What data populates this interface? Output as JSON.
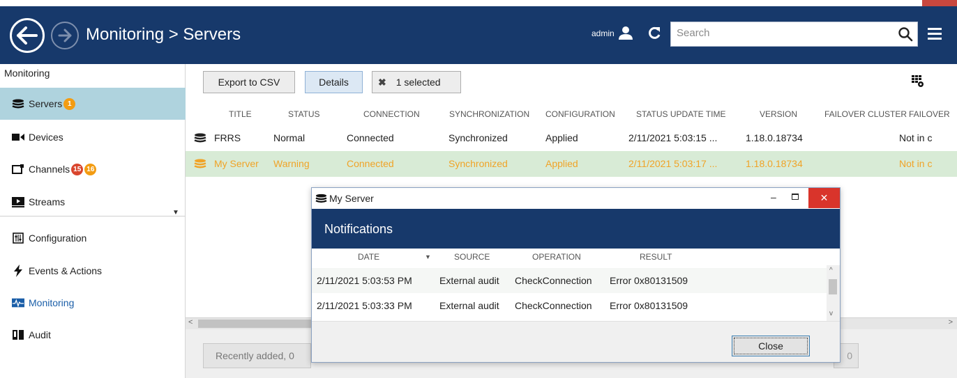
{
  "header": {
    "title": "Monitoring > Servers",
    "user": "admin",
    "search_placeholder": "Search",
    "icons": [
      "back-arrow-icon",
      "forward-arrow-icon",
      "user-icon",
      "refresh-icon",
      "search-icon",
      "menu-icon"
    ],
    "accent": "#17396b"
  },
  "sidebar": {
    "header": "Monitoring",
    "items": [
      {
        "label": "Servers",
        "icon": "server-stack-icon",
        "badges": [
          "1"
        ],
        "active": true
      },
      {
        "label": "Devices",
        "icon": "camera-icon",
        "badges": []
      },
      {
        "label": "Channels",
        "icon": "channel-icon",
        "badges": [
          "15",
          "16"
        ]
      },
      {
        "label": "Streams",
        "icon": "stream-icon",
        "badges": []
      },
      {
        "label": "Configuration",
        "icon": "configuration-icon",
        "badges": []
      },
      {
        "label": "Events & Actions",
        "icon": "lightning-icon",
        "badges": []
      },
      {
        "label": "Monitoring",
        "icon": "monitoring-icon",
        "badges": []
      },
      {
        "label": "Audit",
        "icon": "book-icon",
        "badges": []
      }
    ]
  },
  "toolbar": {
    "export_label": "Export to CSV",
    "details_label": "Details",
    "selected_label": "1 selected",
    "selected_icon": "clear-selection-icon",
    "grid_icon": "grid-settings-icon"
  },
  "table": {
    "columns": [
      "TITLE",
      "STATUS",
      "CONNECTION",
      "SYNCHRONIZATION",
      "CONFIGURATION",
      "STATUS UPDATE TIME",
      "VERSION",
      "FAILOVER CLUSTER",
      "FAILOVER"
    ],
    "rows": [
      {
        "title": "FRRS",
        "status": "Normal",
        "connection": "Connected",
        "sync": "Synchronized",
        "config": "Applied",
        "time": "2/11/2021 5:03:15 ...",
        "version": "1.18.0.18734",
        "cluster": "",
        "failover": "Not in c"
      },
      {
        "title": "My Server",
        "status": "Warning",
        "connection": "Connected",
        "sync": "Synchronized",
        "config": "Applied",
        "time": "2/11/2021 5:03:17 ...",
        "version": "1.18.0.18734",
        "cluster": "",
        "failover": "Not in c"
      }
    ],
    "warning_color": "#f0a327",
    "selected_row_color": "#d8ebd6"
  },
  "bottom": {
    "recent_label": "Recently added, 0",
    "right_label": "0"
  },
  "dialog": {
    "window_title": "My Server",
    "header": "Notifications",
    "columns": [
      "DATE",
      "SOURCE",
      "OPERATION",
      "RESULT"
    ],
    "rows": [
      {
        "date": "2/11/2021 5:03:53 PM",
        "source": "External audit",
        "operation": "CheckConnection",
        "result": "Error 0x80131509"
      },
      {
        "date": "2/11/2021 5:03:33 PM",
        "source": "External audit",
        "operation": "CheckConnection",
        "result": "Error 0x80131509"
      }
    ],
    "close_label": "Close"
  }
}
